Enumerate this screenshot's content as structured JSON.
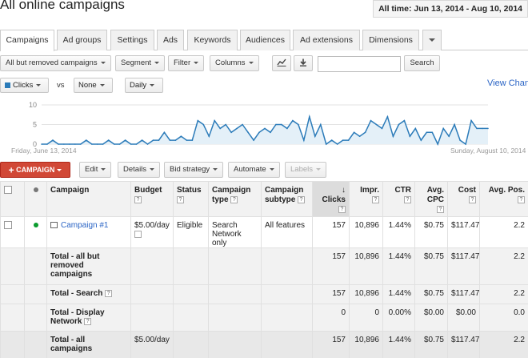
{
  "page": {
    "title": "All online campaigns",
    "date_range": "All time: Jun 13, 2014 - Aug 10, 2014"
  },
  "tabs": [
    {
      "label": "Campaigns",
      "active": true
    },
    {
      "label": "Ad groups"
    },
    {
      "label": "Settings"
    },
    {
      "label": "Ads"
    },
    {
      "label": "Keywords"
    },
    {
      "label": "Audiences"
    },
    {
      "label": "Ad extensions"
    },
    {
      "label": "Dimensions"
    }
  ],
  "toolbar": {
    "filter_scope": "All but removed campaigns",
    "segment": "Segment",
    "filter": "Filter",
    "columns": "Columns",
    "search_placeholder": "",
    "search_button": "Search"
  },
  "chart_controls": {
    "metric1": "Clicks",
    "vs": "vs",
    "metric2": "None",
    "granularity": "Daily",
    "view_change": "View Change"
  },
  "chart_data": {
    "type": "area",
    "series": [
      {
        "name": "Clicks",
        "color": "#2b7bb9",
        "values": [
          0,
          0,
          1,
          0,
          0,
          0,
          0,
          0,
          1,
          0,
          0,
          0,
          1,
          0,
          0,
          1,
          0,
          0,
          1,
          0,
          1,
          1,
          3,
          1,
          1,
          2,
          1,
          1,
          6,
          5,
          2,
          6,
          4,
          5,
          3,
          4,
          5,
          3,
          1,
          3,
          4,
          3,
          5,
          5,
          4,
          6,
          5,
          1,
          7,
          2,
          5,
          0,
          1,
          0,
          1,
          1,
          3,
          2,
          3,
          6,
          5,
          4,
          7,
          2,
          5,
          6,
          2,
          4,
          1,
          3,
          3,
          0,
          4,
          2,
          5,
          1,
          0,
          6,
          4,
          4,
          4
        ]
      }
    ],
    "ylim": [
      0,
      10
    ],
    "y_ticks": [
      "10",
      "5",
      "0"
    ],
    "x_start_label": "Friday, June 13, 2014",
    "x_end_label": "Sunday, August 10, 2014",
    "grid": true
  },
  "actions": {
    "campaign": "CAMPAIGN",
    "edit": "Edit",
    "details": "Details",
    "bid_strategy": "Bid strategy",
    "automate": "Automate",
    "labels": "Labels"
  },
  "table": {
    "headers": {
      "campaign": "Campaign",
      "budget": "Budget",
      "status": "Status",
      "campaign_type": "Campaign type",
      "campaign_subtype": "Campaign subtype",
      "clicks": "Clicks",
      "impr": "Impr.",
      "ctr": "CTR",
      "avg_cpc": "Avg. CPC",
      "cost": "Cost",
      "avg_pos": "Avg. Pos."
    },
    "rows": [
      {
        "campaign": "Campaign #1",
        "budget": "$5.00/day",
        "status": "Eligible",
        "campaign_type": "Search Network only",
        "campaign_subtype": "All features",
        "clicks": "157",
        "impr": "10,896",
        "ctr": "1.44%",
        "avg_cpc": "$0.75",
        "cost": "$117.47",
        "avg_pos": "2.2"
      }
    ],
    "totals": [
      {
        "label": "Total - all but removed campaigns",
        "budget": "",
        "clicks": "157",
        "impr": "10,896",
        "ctr": "1.44%",
        "avg_cpc": "$0.75",
        "cost": "$117.47",
        "avg_pos": "2.2"
      },
      {
        "label": "Total - Search",
        "budget": "",
        "clicks": "157",
        "impr": "10,896",
        "ctr": "1.44%",
        "avg_cpc": "$0.75",
        "cost": "$117.47",
        "avg_pos": "2.2"
      },
      {
        "label": "Total - Display Network",
        "budget": "",
        "clicks": "0",
        "impr": "0",
        "ctr": "0.00%",
        "avg_cpc": "$0.00",
        "cost": "$0.00",
        "avg_pos": "0.0"
      },
      {
        "label": "Total - all campaigns",
        "budget": "$5.00/day",
        "clicks": "157",
        "impr": "10,896",
        "ctr": "1.44%",
        "avg_cpc": "$0.75",
        "cost": "$117.47",
        "avg_pos": "2.2"
      }
    ]
  }
}
